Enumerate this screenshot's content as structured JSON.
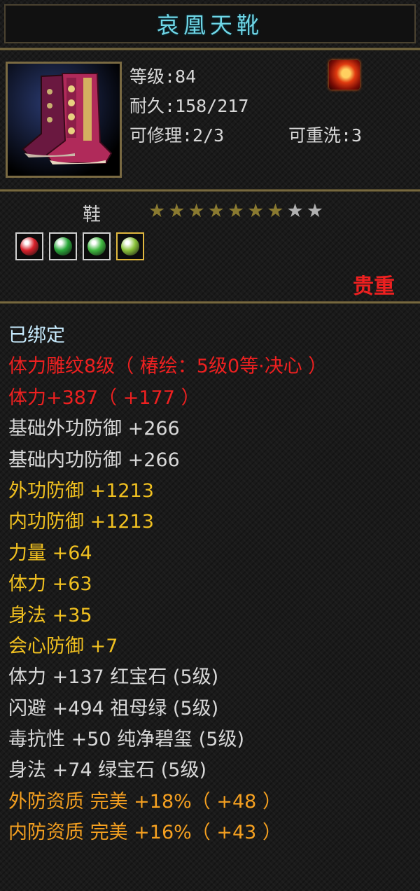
{
  "item": {
    "name": "哀凰天靴",
    "level_text": "等级:84",
    "durability_text": "耐久:158/217",
    "repair_text": "可修理:2/3",
    "rewash_text": "可重洗:3",
    "type": "鞋",
    "stars_filled": 7,
    "stars_total": 9,
    "valuable_label": "贵重",
    "gems": [
      {
        "name": "red-gem",
        "color": "#d8202a"
      },
      {
        "name": "emerald-gem",
        "color": "#2aa83a"
      },
      {
        "name": "green-gem",
        "color": "#3fb83f"
      },
      {
        "name": "jade-gem",
        "color": "#8ac23a"
      }
    ]
  },
  "colors": {
    "white": "#d8d8d8",
    "cyan": "#c8ecff",
    "red": "#ee2020",
    "yellow": "#f0c020",
    "orange": "#f5a020",
    "title": "#6fd6e6",
    "star_filled": "#8a7a30",
    "star_empty": "#b0b0b0"
  },
  "attributes": [
    {
      "text": "已绑定",
      "color": "cyan"
    },
    {
      "text": "体力雕纹8级（ 椿绘：5级0等·决心 ）",
      "color": "red"
    },
    {
      "text": "体力+387（ +177 ）",
      "color": "red"
    },
    {
      "text": "基础外功防御 +266",
      "color": "white"
    },
    {
      "text": "基础内功防御 +266",
      "color": "white"
    },
    {
      "text": "外功防御 +1213",
      "color": "yellow"
    },
    {
      "text": "内功防御 +1213",
      "color": "yellow"
    },
    {
      "text": "力量 +64",
      "color": "yellow"
    },
    {
      "text": "体力 +63",
      "color": "yellow"
    },
    {
      "text": "身法 +35",
      "color": "yellow"
    },
    {
      "text": "会心防御 +7",
      "color": "yellow"
    },
    {
      "text": "体力 +137 红宝石 (5级)",
      "color": "white"
    },
    {
      "text": "闪避 +494 祖母绿 (5级)",
      "color": "white"
    },
    {
      "text": "毒抗性 +50 纯净碧玺 (5级)",
      "color": "white"
    },
    {
      "text": "身法 +74 绿宝石 (5级)",
      "color": "white"
    },
    {
      "text": "外防资质 完美 +18%（ +48 ）",
      "color": "orange"
    },
    {
      "text": "内防资质 完美 +16%（ +43 ）",
      "color": "orange"
    }
  ]
}
